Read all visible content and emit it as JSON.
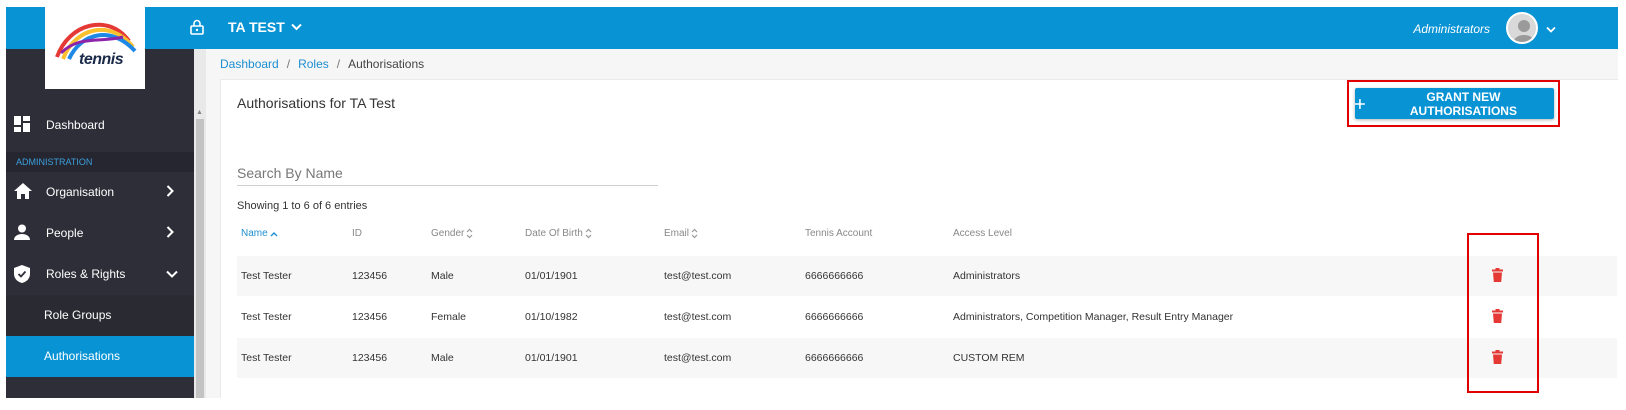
{
  "header": {
    "logo_text": "tennis",
    "org_name": "TA TEST",
    "role": "Administrators"
  },
  "sidebar": {
    "dashboard": "Dashboard",
    "section_label": "ADMINISTRATION",
    "items": [
      {
        "label": "Organisation"
      },
      {
        "label": "People"
      },
      {
        "label": "Roles & Rights"
      }
    ],
    "sub_items": [
      {
        "label": "Role Groups"
      },
      {
        "label": "Authorisations"
      }
    ]
  },
  "breadcrumb": {
    "items": [
      "Dashboard",
      "Roles",
      "Authorisations"
    ],
    "separator": "/"
  },
  "main": {
    "title": "Authorisations for TA Test",
    "grant_button": "GRANT NEW AUTHORISATIONS",
    "search_placeholder": "Search By Name",
    "entries_info": "Showing 1 to 6 of 6 entries",
    "columns": [
      "Name",
      "ID",
      "Gender",
      "Date Of Birth",
      "Email",
      "Tennis Account",
      "Access Level"
    ],
    "rows": [
      {
        "name": "Test Tester",
        "id": "123456",
        "gender": "Male",
        "dob": "01/01/1901",
        "email": "test@test.com",
        "account": "6666666666",
        "access": "Administrators"
      },
      {
        "name": "Test Tester",
        "id": "123456",
        "gender": "Female",
        "dob": "01/10/1982",
        "email": "test@test.com",
        "account": "6666666666",
        "access": "Administrators, Competition Manager, Result Entry Manager"
      },
      {
        "name": "Test Tester",
        "id": "123456",
        "gender": "Male",
        "dob": "01/01/1901",
        "email": "test@test.com",
        "account": "6666666666",
        "access": "CUSTOM REM"
      }
    ]
  },
  "colors": {
    "primary": "#0893d4",
    "sidebar": "#2e2e38",
    "delete": "#e53935",
    "highlight": "#e00000"
  }
}
